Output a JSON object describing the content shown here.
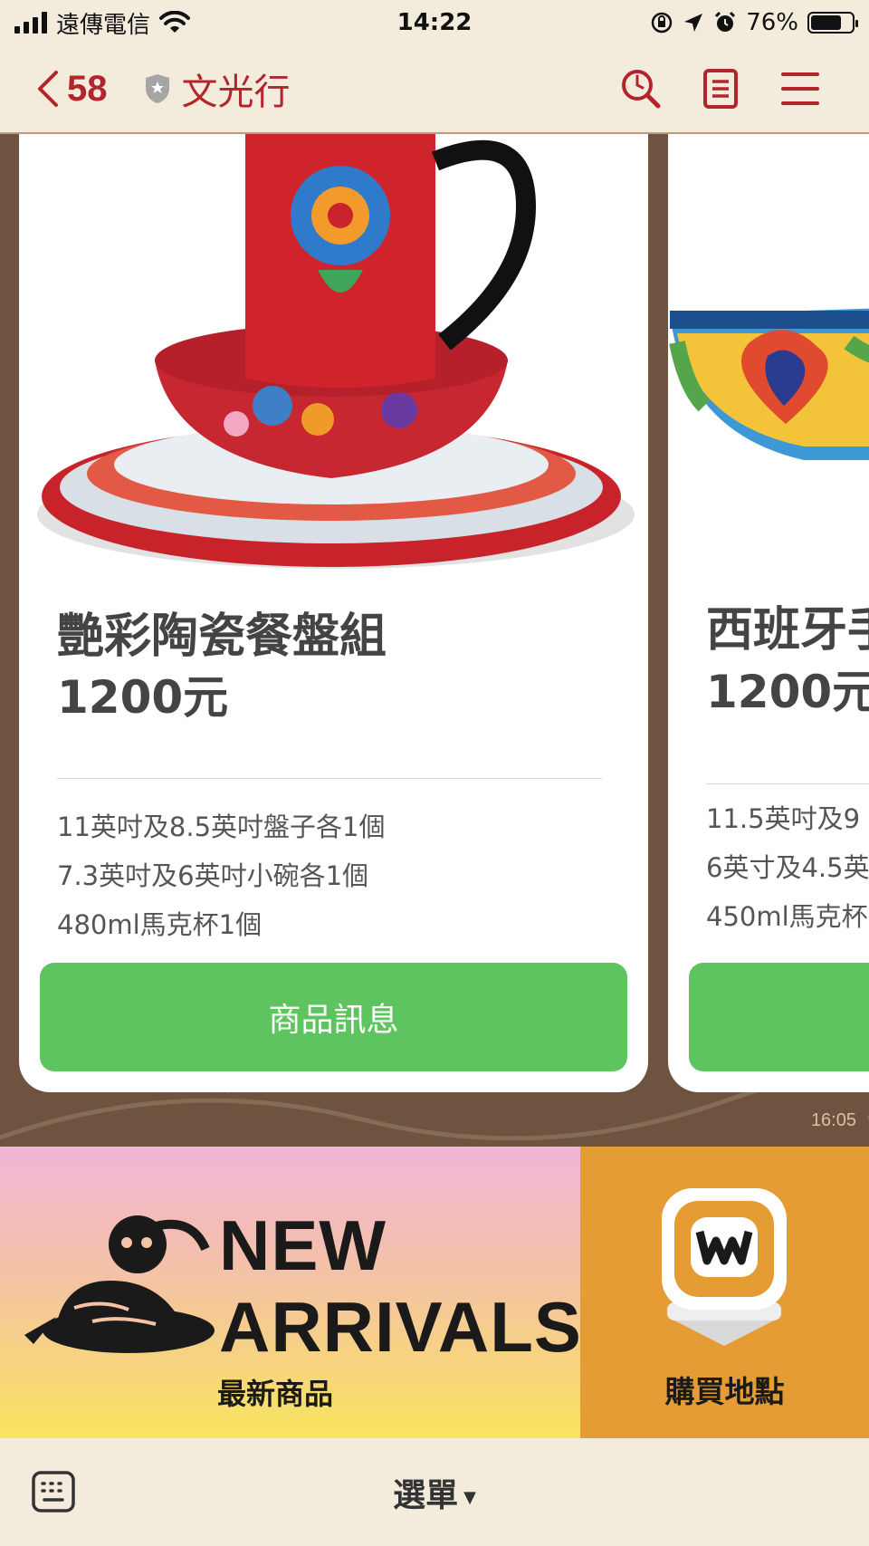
{
  "status_bar": {
    "carrier": "遠傳電信",
    "time": "14:22",
    "battery": "76%",
    "battery_level": 0.76
  },
  "header": {
    "back_count": "58",
    "title": "文光行"
  },
  "cards": [
    {
      "name": "艷彩陶瓷餐盤組",
      "price": "1200元",
      "lines": [
        "11英吋及8.5英吋盤子各1個",
        "7.3英吋及6英吋小碗各1個",
        "480ml馬克杯1個"
      ],
      "button": "商品訊息"
    },
    {
      "name": "西班牙手",
      "price": "1200元",
      "lines": [
        "11.5英吋及9",
        "6英寸及4.5英",
        "450ml馬克杯"
      ],
      "button": ""
    }
  ],
  "message_time": "16:05",
  "rich_menu": {
    "new_title_line1": "NEW",
    "new_title_line2": "ARRIVALS",
    "new_subtitle": "最新商品",
    "buy_subtitle": "購買地點"
  },
  "bottom_bar": {
    "menu_label": "選單"
  },
  "colors": {
    "accent_red": "#b3252d",
    "button_green": "#5ec45f",
    "chat_bg": "#6e5440",
    "buy_orange": "#e69c35"
  }
}
